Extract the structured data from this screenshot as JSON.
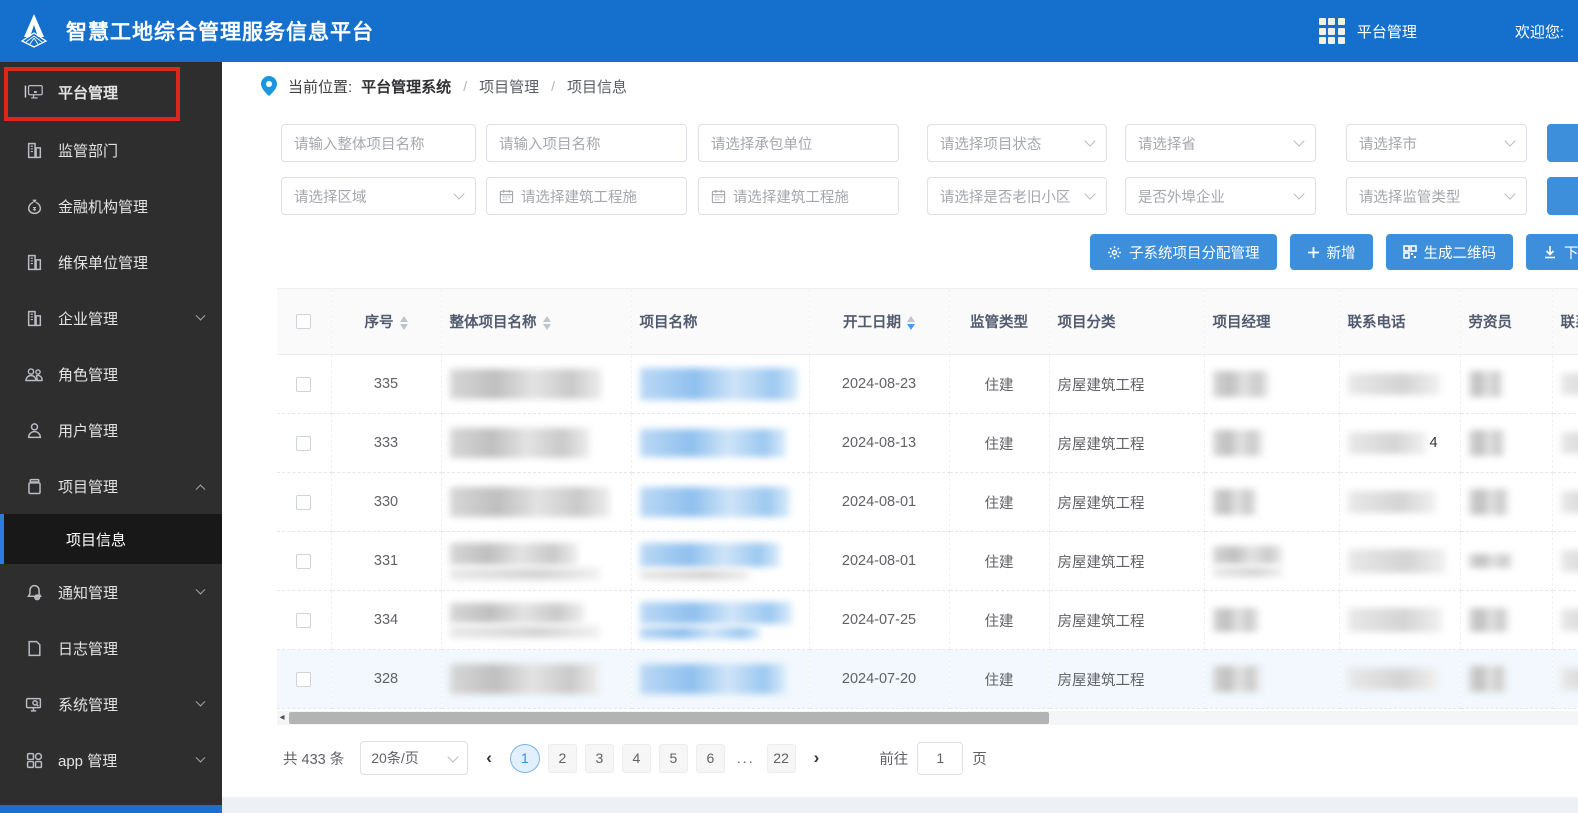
{
  "header": {
    "title": "智慧工地综合管理服务信息平台",
    "nav_platform": "平台管理",
    "welcome": "欢迎您:"
  },
  "sidebar": {
    "top_item": {
      "label": "平台管理",
      "icon": "monitor-icon"
    },
    "items": [
      {
        "label": "监管部门",
        "icon": "building-icon"
      },
      {
        "label": "金融机构管理",
        "icon": "moneybag-icon"
      },
      {
        "label": "维保单位管理",
        "icon": "building-icon"
      },
      {
        "label": "企业管理",
        "icon": "building-icon",
        "expandable": true
      },
      {
        "label": "角色管理",
        "icon": "users-icon"
      },
      {
        "label": "用户管理",
        "icon": "user-icon"
      },
      {
        "label": "项目管理",
        "icon": "project-icon",
        "expandable": true,
        "expanded": true
      },
      {
        "label": "通知管理",
        "icon": "bell-icon",
        "expandable": true
      },
      {
        "label": "日志管理",
        "icon": "log-icon"
      },
      {
        "label": "系统管理",
        "icon": "system-icon",
        "expandable": true
      },
      {
        "label": "app 管理",
        "icon": "app-icon",
        "expandable": true
      }
    ],
    "submenu": {
      "parent": "项目管理",
      "label": "项目信息",
      "selected": true
    }
  },
  "breadcrumb": {
    "prefix": "当前位置:",
    "root": "平台管理系统",
    "sep": "/",
    "item1": "项目管理",
    "item2": "项目信息"
  },
  "filters": {
    "row1": [
      {
        "placeholder": "请输入整体项目名称",
        "type": "input"
      },
      {
        "placeholder": "请输入项目名称",
        "type": "input"
      },
      {
        "placeholder": "请选择承包单位",
        "type": "select"
      },
      {
        "placeholder": "请选择项目状态",
        "type": "select"
      },
      {
        "placeholder": "请选择省",
        "type": "select"
      },
      {
        "placeholder": "请选择市",
        "type": "select"
      }
    ],
    "row2": [
      {
        "placeholder": "请选择区域",
        "type": "select"
      },
      {
        "placeholder": "请选择建筑工程施",
        "type": "date"
      },
      {
        "placeholder": "请选择建筑工程施",
        "type": "date"
      },
      {
        "placeholder": "请选择是否老旧小区",
        "type": "select"
      },
      {
        "placeholder": "是否外埠企业",
        "type": "select"
      },
      {
        "placeholder": "请选择监管类型",
        "type": "select"
      }
    ]
  },
  "actions": [
    {
      "label": "子系统项目分配管理",
      "icon": "gear-icon"
    },
    {
      "label": "新增",
      "icon": "plus-icon"
    },
    {
      "label": "生成二维码",
      "icon": "qrcode-icon"
    },
    {
      "label": "下载",
      "icon": "download-icon"
    }
  ],
  "table": {
    "columns": {
      "seq": "序号",
      "overall_name": "整体项目名称",
      "project_name": "项目名称",
      "start_date": "开工日期",
      "supervision": "监管类型",
      "category": "项目分类",
      "manager": "项目经理",
      "phone": "联系电话",
      "labor_officer": "劳资员",
      "labor_phone": "联系电话"
    },
    "sort": {
      "active_column": "开工日期",
      "direction": "desc"
    },
    "rows": [
      {
        "seq": "335",
        "start_date": "2024-08-23",
        "supervision": "住建",
        "category": "房屋建筑工程",
        "phone_extra": ""
      },
      {
        "seq": "333",
        "start_date": "2024-08-13",
        "supervision": "住建",
        "category": "房屋建筑工程",
        "phone_extra": "4"
      },
      {
        "seq": "330",
        "start_date": "2024-08-01",
        "supervision": "住建",
        "category": "房屋建筑工程",
        "phone_extra": ""
      },
      {
        "seq": "331",
        "start_date": "2024-08-01",
        "supervision": "住建",
        "category": "房屋建筑工程",
        "phone_extra": ""
      },
      {
        "seq": "334",
        "start_date": "2024-07-25",
        "supervision": "住建",
        "category": "房屋建筑工程",
        "phone_extra": ""
      },
      {
        "seq": "328",
        "start_date": "2024-07-20",
        "supervision": "住建",
        "category": "房屋建筑工程",
        "phone_extra": ""
      }
    ]
  },
  "pagination": {
    "total": "共 433 条",
    "page_size": "20条/页",
    "pages": [
      "1",
      "2",
      "3",
      "4",
      "5",
      "6",
      "...",
      "22"
    ],
    "active_page": "1",
    "goto_label": "前往",
    "goto_value": "1",
    "goto_suffix": "页"
  },
  "colors": {
    "header_blue": "#1470cc",
    "button_blue": "#3d8fdc",
    "sidebar_bg": "#2e2e2e",
    "annotation_red": "#dd271a",
    "active_page_blue": "#3a8ee6",
    "sort_active_blue": "#409eff"
  }
}
